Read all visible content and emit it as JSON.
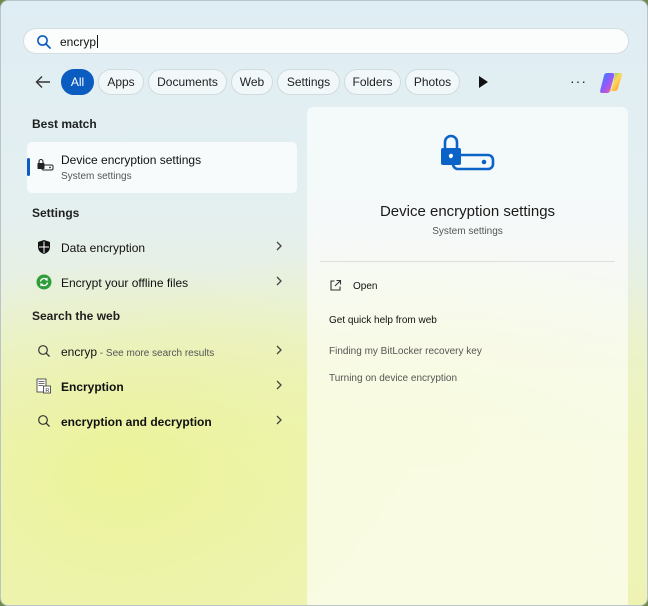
{
  "search": {
    "query": "encryp"
  },
  "filters": [
    {
      "label": "All",
      "active": true
    },
    {
      "label": "Apps"
    },
    {
      "label": "Documents"
    },
    {
      "label": "Web"
    },
    {
      "label": "Settings"
    },
    {
      "label": "Folders"
    },
    {
      "label": "Photos"
    }
  ],
  "more_label": "···",
  "best_match": {
    "heading": "Best match",
    "title": "Device encryption settings",
    "subtitle": "System settings"
  },
  "settings": {
    "heading": "Settings",
    "items": [
      {
        "label": "Data encryption",
        "icon": "shield-icon"
      },
      {
        "label": "Encrypt your offline files",
        "icon": "sync-icon"
      }
    ]
  },
  "web": {
    "heading": "Search the web",
    "items": [
      {
        "label": "encryp",
        "suffix": " - See more search results",
        "icon": "search-icon"
      },
      {
        "label": "Encryption",
        "icon": "document-icon"
      },
      {
        "label": "encryption and decryption",
        "icon": "search-icon"
      }
    ]
  },
  "preview": {
    "title": "Device encryption settings",
    "subtitle": "System settings",
    "open_label": "Open",
    "help_heading": "Get quick help from web",
    "links": [
      "Finding my BitLocker recovery key",
      "Turning on device encryption"
    ]
  },
  "colors": {
    "accent": "#0b5cc0"
  }
}
